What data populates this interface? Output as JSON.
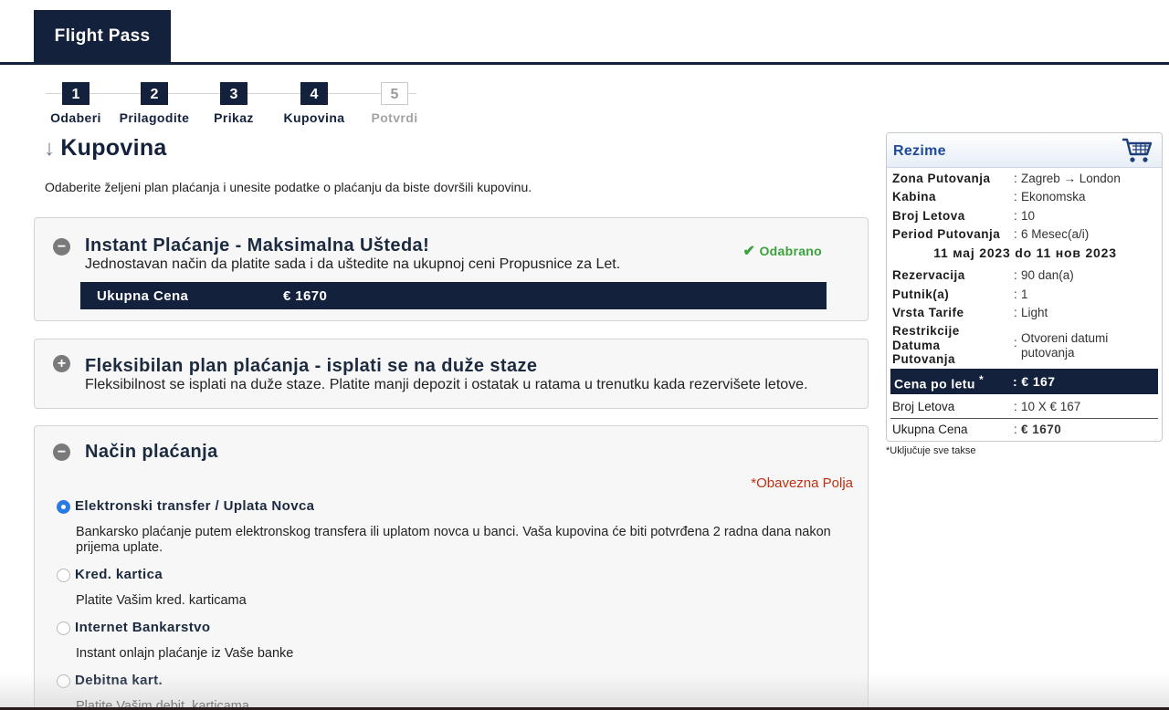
{
  "header": {
    "tab_label": "Flight Pass"
  },
  "steps": [
    {
      "num": "1",
      "label": "Odaberi",
      "active": true
    },
    {
      "num": "2",
      "label": "Prilagodite",
      "active": true
    },
    {
      "num": "3",
      "label": "Prikaz",
      "active": true
    },
    {
      "num": "4",
      "label": "Kupovina",
      "active": true
    },
    {
      "num": "5",
      "label": "Potvrdi",
      "active": false
    }
  ],
  "main": {
    "title_arrow": "↓",
    "title": "Kupovina",
    "intro": "Odaberite željeni plan plaćanja i unesite podatke o plaćanju da biste dovršili kupovinu.",
    "instant": {
      "toggle": "−",
      "title": "Instant Plaćanje - Maksimalna Ušteda!",
      "subtitle": "Jednostavan način da platite sada i da uštedite na ukupnoj ceni Propusnice za Let.",
      "selected_label": "Odabrano",
      "total_label": "Ukupna Cena",
      "total_value": "€ 1670"
    },
    "flexible": {
      "toggle": "+",
      "title": "Fleksibilan plan plaćanja - isplati se na duže staze",
      "subtitle": "Fleksibilnost se isplati na duže staze. Platite manji depozit i ostatak u ratama u trenutku kada rezervišete letove."
    },
    "payment": {
      "toggle": "−",
      "title": "Način plaćanja",
      "required_note": "*Obavezna Polja",
      "options": [
        {
          "label": "Elektronski transfer / Uplata Novca",
          "desc": "Bankarsko plaćanje putem elektronskog transfera ili uplatom novca u banci. Vaša kupovina će biti potvrđena 2 radna dana nakon prijema uplate.",
          "selected": true
        },
        {
          "label": "Kred. kartica",
          "desc": "Platite Vašim kred. karticama",
          "selected": false
        },
        {
          "label": "Internet Bankarstvo",
          "desc": "Instant onlajn plaćanje iz Vaše banke",
          "selected": false
        },
        {
          "label": "Debitna kart.",
          "desc": "Platite Vašim debit. karticama",
          "selected": false
        }
      ]
    }
  },
  "summary": {
    "title": "Rezime",
    "cart_icon": "shopping-cart-icon",
    "colon": ":",
    "rows_top": [
      {
        "key": "Zona Putovanja",
        "value": "Zagreb → London"
      },
      {
        "key": "Kabina",
        "value": "Ekonomska"
      },
      {
        "key": "Broj Letova",
        "value": "10"
      },
      {
        "key": "Period Putovanja",
        "value": "6 Mesec(a/i)"
      }
    ],
    "date_range": "11 мај 2023 do 11 нов 2023",
    "rows_mid": [
      {
        "key": "Rezervacija",
        "value": "90 dan(a)"
      },
      {
        "key": "Putnik(a)",
        "value": "1"
      },
      {
        "key": "Vrsta Tarife",
        "value": "Light"
      }
    ],
    "restrictions_key": "Restrikcije Datuma Putovanja",
    "restrictions_value": "Otvoreni datumi putovanja",
    "price_per_flight_label": "Cena po letu",
    "price_per_flight_mark": "*",
    "price_per_flight_value": ": € 167",
    "flights_label": "Broj Letova",
    "flights_value": "10 X € 167",
    "total_label": "Ukupna Cena",
    "total_value": "€ 1670",
    "footnote": "*Uključuje sve takse"
  },
  "colors": {
    "navy": "#14213d",
    "selected_green": "#3aa23a",
    "required_red": "#c03010",
    "radio_blue": "#2a7ae4"
  }
}
